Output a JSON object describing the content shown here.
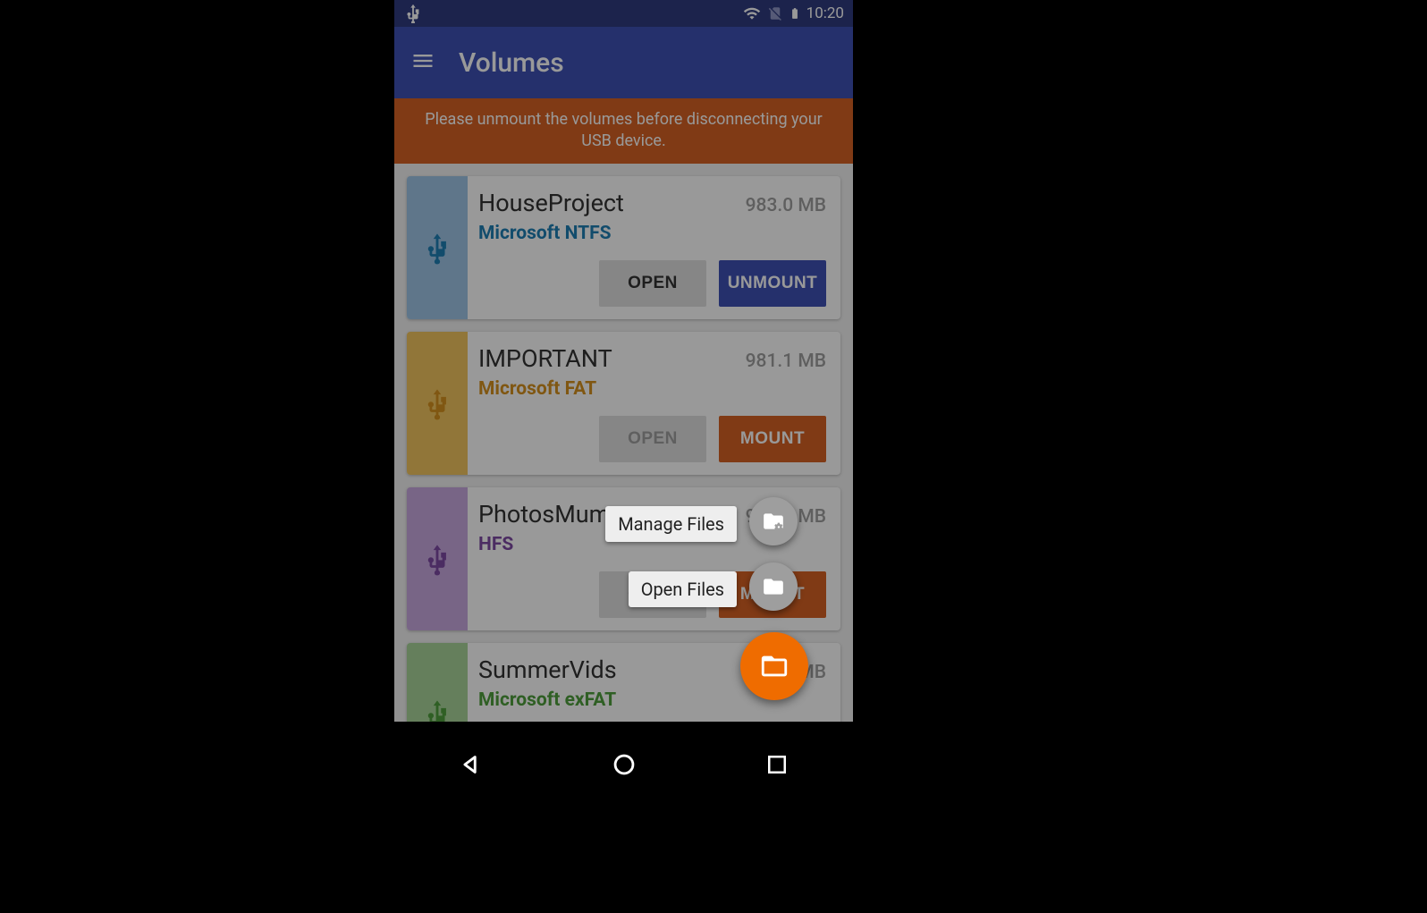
{
  "statusbar": {
    "time": "10:20"
  },
  "appbar": {
    "title": "Volumes"
  },
  "banner": {
    "text": "Please unmount the volumes before disconnecting your USB device."
  },
  "buttons": {
    "open": "OPEN",
    "unmount": "UNMOUNT",
    "mount": "MOUNT"
  },
  "volumes": [
    {
      "name": "HouseProject",
      "size": "983.0 MB",
      "fs": "Microsoft NTFS",
      "stripe": "#9ec5e6",
      "fs_color": "#1f7fb5",
      "mounted": true,
      "open_enabled": true
    },
    {
      "name": "IMPORTANT",
      "size": "981.1 MB",
      "fs": "Microsoft FAT",
      "stripe": "#f2c55f",
      "fs_color": "#d6911f",
      "mounted": false,
      "open_enabled": false
    },
    {
      "name": "PhotosMum",
      "size": "983.0 MB",
      "fs": "HFS",
      "stripe": "#c9a8e0",
      "fs_color": "#7e4aa3",
      "mounted": false,
      "open_enabled": true
    },
    {
      "name": "SummerVids",
      "size": "981.0 MB",
      "fs": "Microsoft exFAT",
      "stripe": "#a8d49a",
      "fs_color": "#4f9f3d",
      "mounted": false,
      "open_enabled": true
    }
  ],
  "fab": {
    "open_files": "Open Files",
    "manage_files": "Manage Files"
  }
}
